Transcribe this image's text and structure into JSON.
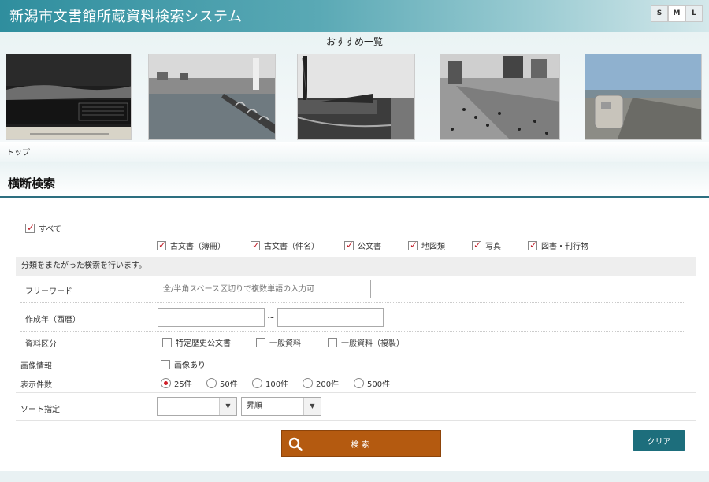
{
  "header": {
    "title": "新潟市文書館所蔵資料検索システム",
    "size_buttons": [
      "S",
      "M",
      "L"
    ],
    "active_size": "M"
  },
  "recommend": {
    "title": "おすすめ一覧",
    "thumbnails": [
      {
        "name": "thumbnail-1"
      },
      {
        "name": "thumbnail-2"
      },
      {
        "name": "thumbnail-3"
      },
      {
        "name": "thumbnail-4"
      },
      {
        "name": "thumbnail-5"
      }
    ]
  },
  "breadcrumb": {
    "top": "トップ"
  },
  "section": {
    "title": "横断検索"
  },
  "categories": {
    "all_label": "すべて",
    "all_checked": true,
    "items": [
      {
        "label": "古文書（簿冊）",
        "checked": true
      },
      {
        "label": "古文書（件名）",
        "checked": true
      },
      {
        "label": "公文書",
        "checked": true
      },
      {
        "label": "地図類",
        "checked": true
      },
      {
        "label": "写真",
        "checked": true
      },
      {
        "label": "図書・刊行物",
        "checked": true
      }
    ]
  },
  "notice": "分類をまたがった検索を行います。",
  "freeword": {
    "label": "フリーワード",
    "placeholder": "全/半角スペース区切りで複数単語の入力可",
    "value": ""
  },
  "year": {
    "label": "作成年（西暦）",
    "from": "",
    "to": "",
    "separator": "~"
  },
  "doc_type": {
    "label": "資料区分",
    "options": [
      {
        "label": "特定歴史公文書",
        "checked": false
      },
      {
        "label": "一般資料",
        "checked": false
      },
      {
        "label": "一般資料（複製）",
        "checked": false
      }
    ]
  },
  "image_info": {
    "label": "画像情報",
    "option": "画像あり",
    "checked": false
  },
  "display_count": {
    "label": "表示件数",
    "options": [
      "25件",
      "50件",
      "100件",
      "200件",
      "500件"
    ],
    "selected": "25件"
  },
  "sort": {
    "label": "ソート指定",
    "field": "",
    "order": "昇順"
  },
  "buttons": {
    "search": "検索",
    "clear": "クリア"
  },
  "colors": {
    "accent": "#2d6f80",
    "search_button": "#b45a10",
    "clear_button": "#1d6e7c",
    "check_mark": "#c0202a"
  }
}
